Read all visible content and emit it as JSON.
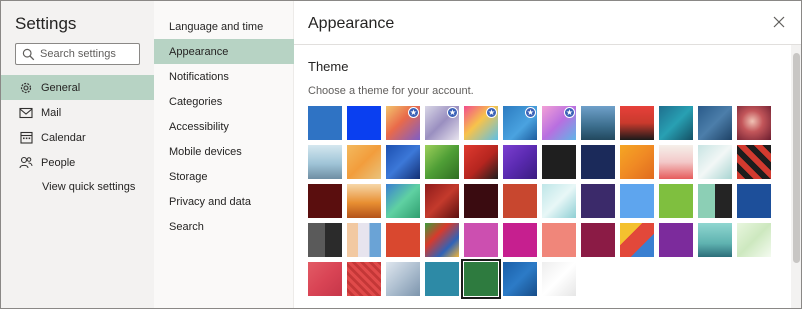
{
  "settings": {
    "title": "Settings",
    "search": {
      "placeholder": "Search settings",
      "value": ""
    },
    "nav": [
      {
        "label": "General",
        "icon": "gear-icon",
        "selected": true
      },
      {
        "label": "Mail",
        "icon": "mail-icon",
        "selected": false
      },
      {
        "label": "Calendar",
        "icon": "calendar-icon",
        "selected": false
      },
      {
        "label": "People",
        "icon": "people-icon",
        "selected": false
      }
    ],
    "view_quick_settings": "View quick settings"
  },
  "submenu": [
    {
      "label": "Language and time",
      "selected": false
    },
    {
      "label": "Appearance",
      "selected": true
    },
    {
      "label": "Notifications",
      "selected": false
    },
    {
      "label": "Categories",
      "selected": false
    },
    {
      "label": "Accessibility",
      "selected": false
    },
    {
      "label": "Mobile devices",
      "selected": false
    },
    {
      "label": "Storage",
      "selected": false
    },
    {
      "label": "Privacy and data",
      "selected": false
    },
    {
      "label": "Search",
      "selected": false
    }
  ],
  "panel": {
    "title": "Appearance",
    "close_icon": "close-icon",
    "theme_heading": "Theme",
    "theme_description": "Choose a theme for your account."
  },
  "colors": {
    "accent_selected": "#b7d3c4",
    "left_bg": "#f3f2f1",
    "middle_bg": "#faf9f8"
  },
  "themes": [
    [
      {
        "bg": "#2f73c4"
      },
      {
        "bg": "#0a3ff0"
      },
      {
        "bg": "linear-gradient(135deg,#f2c46d 0%,#e96a4a 45%,#7d5ec8 100%)",
        "star": true
      },
      {
        "bg": "linear-gradient(135deg,#d9d7e6 0%,#9a8fc0 50%,#e7e3ee 100%)",
        "star": true
      },
      {
        "bg": "linear-gradient(135deg,#f24d8d 0%,#f7c34b 45%,#5dc0e6 100%)",
        "star": true
      },
      {
        "bg": "linear-gradient(135deg,#2c7bc0 0%,#4aa3e0 60%,#1d5c9e 100%)",
        "star": true
      },
      {
        "bg": "linear-gradient(135deg,#f3a0d6 0%,#b86fe0 50%,#5fb4e8 100%)",
        "star": true
      },
      {
        "bg": "linear-gradient(180deg,#6fa0c9 0%,#3b6d8c 60%,#22485e 100%)"
      },
      {
        "bg": "linear-gradient(180deg,#e7403a 0%,#c93a2d 50%,#1a1a1a 100%)"
      },
      {
        "bg": "linear-gradient(135deg,#1f6f8e 0%,#28a0b3 50%,#145064 100%)"
      },
      {
        "bg": "linear-gradient(135deg,#2a5b8a 0%,#4c7eaa 50%,#1e4266 100%)"
      },
      {
        "bg": "radial-gradient(circle at 45% 45%,#f0c2b4 0%,#c3565a 40%,#6b1d2f 100%)"
      }
    ],
    [
      {
        "bg": "linear-gradient(180deg,#d4e7ef 0%,#9fc4d7 55%,#6f8ea3 100%)"
      },
      {
        "bg": "linear-gradient(135deg,#f3b95e 0%,#f29d3c 50%,#e9c37c 100%)"
      },
      {
        "bg": "linear-gradient(135deg,#1c4fb0 0%,#3c78d8 50%,#132f73 100%)"
      },
      {
        "bg": "linear-gradient(135deg,#9ccf5a 0%,#4f9e36 50%,#2f6e22 100%)"
      },
      {
        "bg": "linear-gradient(135deg,#df3a2f 0%,#b5251f 55%,#1e1e1e 100%)"
      },
      {
        "bg": "linear-gradient(135deg,#7b3fd0 0%,#5a2ab0 50%,#3a1c80 100%)"
      },
      {
        "bg": "#1f1f1f"
      },
      {
        "bg": "#1b2a5a"
      },
      {
        "bg": "linear-gradient(135deg,#f5a623 0%,#f08a24 50%,#e06b1f 100%)"
      },
      {
        "bg": "linear-gradient(180deg,#f5f0ea 0%,#f3c9c9 50%,#e65c5c 100%)"
      },
      {
        "bg": "linear-gradient(135deg,#c8e4e3 0%,#f2f7f6 50%,#a9d5d2 100%)"
      },
      {
        "bg": "repeating-linear-gradient(45deg,#d23a2f 0 6px,#1d1d1d 6px 12px)"
      }
    ],
    [
      {
        "bg": "#5a0e0e"
      },
      {
        "bg": "linear-gradient(180deg,#f6d7a8 0%,#e88f32 55%,#b4531a 100%)"
      },
      {
        "bg": "linear-gradient(135deg,#3a7fd1 0%,#5fd1a2 50%,#2f9e6f 100%)"
      },
      {
        "bg": "linear-gradient(135deg,#8e1b1b 0%,#c43a2c 50%,#5b0f0f 100%)"
      },
      {
        "bg": "#3a0b10"
      },
      {
        "bg": "#c8472f"
      },
      {
        "bg": "linear-gradient(135deg,#bfe6e8 0%,#e8f7f7 50%,#8fcfd4 100%)"
      },
      {
        "bg": "#3b2a6a"
      },
      {
        "bg": "#5ea5ee"
      },
      {
        "bg": "#7fbf3f"
      },
      {
        "bg": "linear-gradient(90deg,#8ccfb5 0 50%,#242424 50% 100%)"
      },
      {
        "bg": "#1d4f9a"
      }
    ],
    [
      {
        "bg": "linear-gradient(90deg,#5a5a5a 0 50%,#2b2b2b 50% 100%)"
      },
      {
        "bg": "linear-gradient(90deg,#f2c9a2 0 33%,#e7e4ee 33% 66%,#6aa3d6 66% 100%)"
      },
      {
        "bg": "#d9482f"
      },
      {
        "bg": "linear-gradient(135deg,#3b9d3a 0%,#d73a2c 35%,#2f63b8 70%,#f0b53a 100%)"
      },
      {
        "bg": "#cc4fb0"
      },
      {
        "bg": "#c61f8f"
      },
      {
        "bg": "#f0867a"
      },
      {
        "bg": "#8b1b45"
      },
      {
        "bg": "linear-gradient(135deg,#f4c12f 0 33%,#e2483a 33% 66%,#3a7fd1 66% 100%)"
      },
      {
        "bg": "#7c2b9c"
      },
      {
        "bg": "linear-gradient(180deg,#8fd6d0 0%,#5fb3b0 60%,#2d6f7a 100%)"
      },
      {
        "bg": "linear-gradient(135deg,#e8f6de 0%,#cde8bf 50%,#f4fbf0 100%)"
      }
    ],
    [
      {
        "bg": "linear-gradient(135deg,#e25b65 0%,#d94455 50%,#c63649 100%)"
      },
      {
        "bg": "repeating-linear-gradient(45deg,#e04a4a 0 3px,#c43737 3px 6px)"
      },
      {
        "bg": "linear-gradient(135deg,#dfe6ee 0%,#aebfd0 50%,#7d95ad 100%)"
      },
      {
        "bg": "#2d8aa6"
      },
      {
        "bg": "#2e7b3f",
        "selected": true
      },
      {
        "bg": "linear-gradient(135deg,#1a5fa8 0%,#2c7bc7 50%,#174c88 100%)"
      },
      {
        "bg": "linear-gradient(135deg,#eeeeee 0%,#ffffff 50%,#e6e6e6 100%)"
      }
    ]
  ]
}
